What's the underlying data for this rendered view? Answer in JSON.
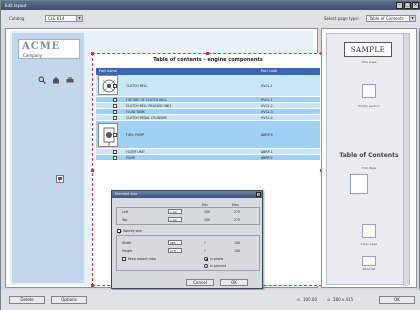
{
  "window": {
    "title": "Edit layout"
  },
  "toolbar": {
    "catalog_label": "Catalog",
    "catalog_value": "CLE E14",
    "pagetype_label": "Select page type:",
    "pagetype_value": "Table of Contents"
  },
  "logo": {
    "text": "ACME",
    "subtext": "Company"
  },
  "page": {
    "title": "Table of contents - engine components",
    "columns": [
      "Part name",
      "Part code"
    ],
    "rows": [
      {
        "name": "CLUTCH BELL",
        "code": "HVCL-1"
      },
      {
        "name": "FIXTURE OF CLUTCH BELL",
        "code": "HVCL-1"
      },
      {
        "name": "CLUTCH BELL RELEASE UNIT",
        "code": "HVCL-2"
      },
      {
        "name": "FLUID TANK",
        "code": "HVCL-3"
      },
      {
        "name": "CLUTCH PEDAL CYLINDER",
        "code": "HVCL-4"
      },
      {
        "name": "FUEL PUMP",
        "code": "ABRP-S"
      },
      {
        "name": "FILTER UNIT",
        "code": "ABRP-1"
      },
      {
        "name": "PUMP",
        "code": "ABRP-2"
      }
    ]
  },
  "sidebar": {
    "sample": "SAMPLE",
    "thumbs": [
      "Title page",
      "Empty section",
      "Table of Contents",
      "TOC Page",
      "Index page",
      "Empty section",
      "Parts list"
    ],
    "toc_heading": "Table of Contents"
  },
  "dialog": {
    "title": "Element size",
    "col_min": "Min",
    "col_max": "Max",
    "left_label": "Left",
    "left_value": "1.00",
    "left_min": "100",
    "left_max": "275",
    "top_label": "Top",
    "top_value": "1.00",
    "top_min": "100",
    "top_max": "275",
    "specify_label": "Specify size",
    "width_label": "Width",
    "width_value": "285",
    "width_min": "?",
    "width_max": "100",
    "height_label": "Height",
    "height_value": "275",
    "height_min": "?",
    "height_max": "100",
    "keep_ratio": "Keep aspect ratio",
    "unit_pixels": "in pixels",
    "unit_percent": "in percent",
    "cancel": "Cancel",
    "ok": "OK"
  },
  "bottom": {
    "delete": "Delete",
    "options": "Options",
    "zoom": "100.00",
    "size": "280 x 415",
    "ok": "OK"
  },
  "colors": {
    "accent": "#3a67b3",
    "row_alt": "#9fd2f2",
    "row_plain": "#c7e6f8"
  }
}
